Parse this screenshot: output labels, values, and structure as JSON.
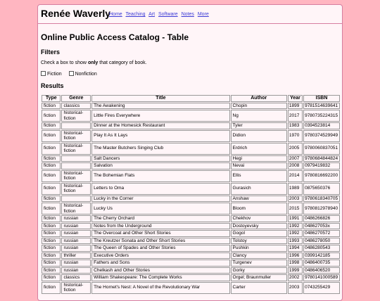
{
  "site": {
    "title": "Renée Waverly",
    "nav": [
      "Home",
      "Teaching",
      "Art",
      "Software",
      "Notes",
      "More"
    ]
  },
  "page": {
    "heading": "Online Public Access Catalog - Table",
    "filters_heading": "Filters",
    "filters_desc_before": "Check a box to show ",
    "filters_desc_bold": "only",
    "filters_desc_after": " that category of book.",
    "filter_fiction": "Fiction",
    "filter_nonfiction": "Nonfiction",
    "results_heading": "Results"
  },
  "table": {
    "headers": [
      "Type",
      "Genre",
      "Title",
      "Author",
      "Year",
      "ISBN"
    ],
    "rows": [
      [
        "fiction",
        "classics",
        "The Awakening",
        "Chopin",
        "1899",
        "9781514639641"
      ],
      [
        "fiction",
        "historical-fiction",
        "Little Fires Everywhere",
        "Ng",
        "2017",
        "9780735224315"
      ],
      [
        "fiction",
        "",
        "Dinner at the Homesick Restaurant",
        "Tyler",
        "1983",
        "0394523814"
      ],
      [
        "fiction",
        "historical-fiction",
        "Play It As It Lays",
        "Didion",
        "1970",
        "9780374529949"
      ],
      [
        "fiction",
        "historical-fiction",
        "The Master Butchers Singing Club",
        "Erdrich",
        "2005",
        "9780060837051"
      ],
      [
        "fiction",
        "",
        "Salt Dancers",
        "Hegi",
        "2007",
        "9780684844824"
      ],
      [
        "fiction",
        "",
        "Salvation",
        "Nevai",
        "2008",
        "0979419832"
      ],
      [
        "fiction",
        "historical-fiction",
        "The Bohemian Flats",
        "Ellis",
        "2014",
        "9780816692200"
      ],
      [
        "fiction",
        "historical-fiction",
        "Letters to Oma",
        "Gurasich",
        "1989",
        "0875650376"
      ],
      [
        "fiction",
        "",
        "Lucky in the Corner",
        "Anshaw",
        "2003",
        "9780618340705"
      ],
      [
        "fiction",
        "historical-fiction",
        "Lucky Us",
        "Bloom",
        "2015",
        "9780812978940"
      ],
      [
        "fiction",
        "russian",
        "The Cherry Orchard",
        "Chekhov",
        "1991",
        "0486266826"
      ],
      [
        "fiction",
        "russian",
        "Notes from the Underground",
        "Dostoyevsky",
        "1992",
        "048627053x"
      ],
      [
        "fiction",
        "russian",
        "The Overcoat and Other Short Stories",
        "Gogol",
        "1992",
        "0486270572"
      ],
      [
        "fiction",
        "russian",
        "The Kreutzer Sonata and Other Short Stories",
        "Tolstoy",
        "1993",
        "0486278050"
      ],
      [
        "fiction",
        "russian",
        "The Queen of Spades and Other Stories",
        "Pushkin",
        "1994",
        "0486280543"
      ],
      [
        "fiction",
        "thriller",
        "Executive Orders",
        "Clancy",
        "1996",
        "0399142185"
      ],
      [
        "fiction",
        "russian",
        "Fathers and Sons",
        "Turgenev",
        "1998",
        "0486400735"
      ],
      [
        "fiction",
        "russian",
        "Chelkash and Other Stories",
        "Gorky",
        "1999",
        "0486406520"
      ],
      [
        "fiction",
        "classics",
        "William Shakespeare: The Complete Works",
        "Orgel; Braunmuller",
        "2002",
        "9780141000589"
      ],
      [
        "fiction",
        "historical-fiction",
        "The Hornet's Nest: A Novel of the Revolutionary War",
        "Carter",
        "2003",
        "0743255429"
      ]
    ]
  }
}
